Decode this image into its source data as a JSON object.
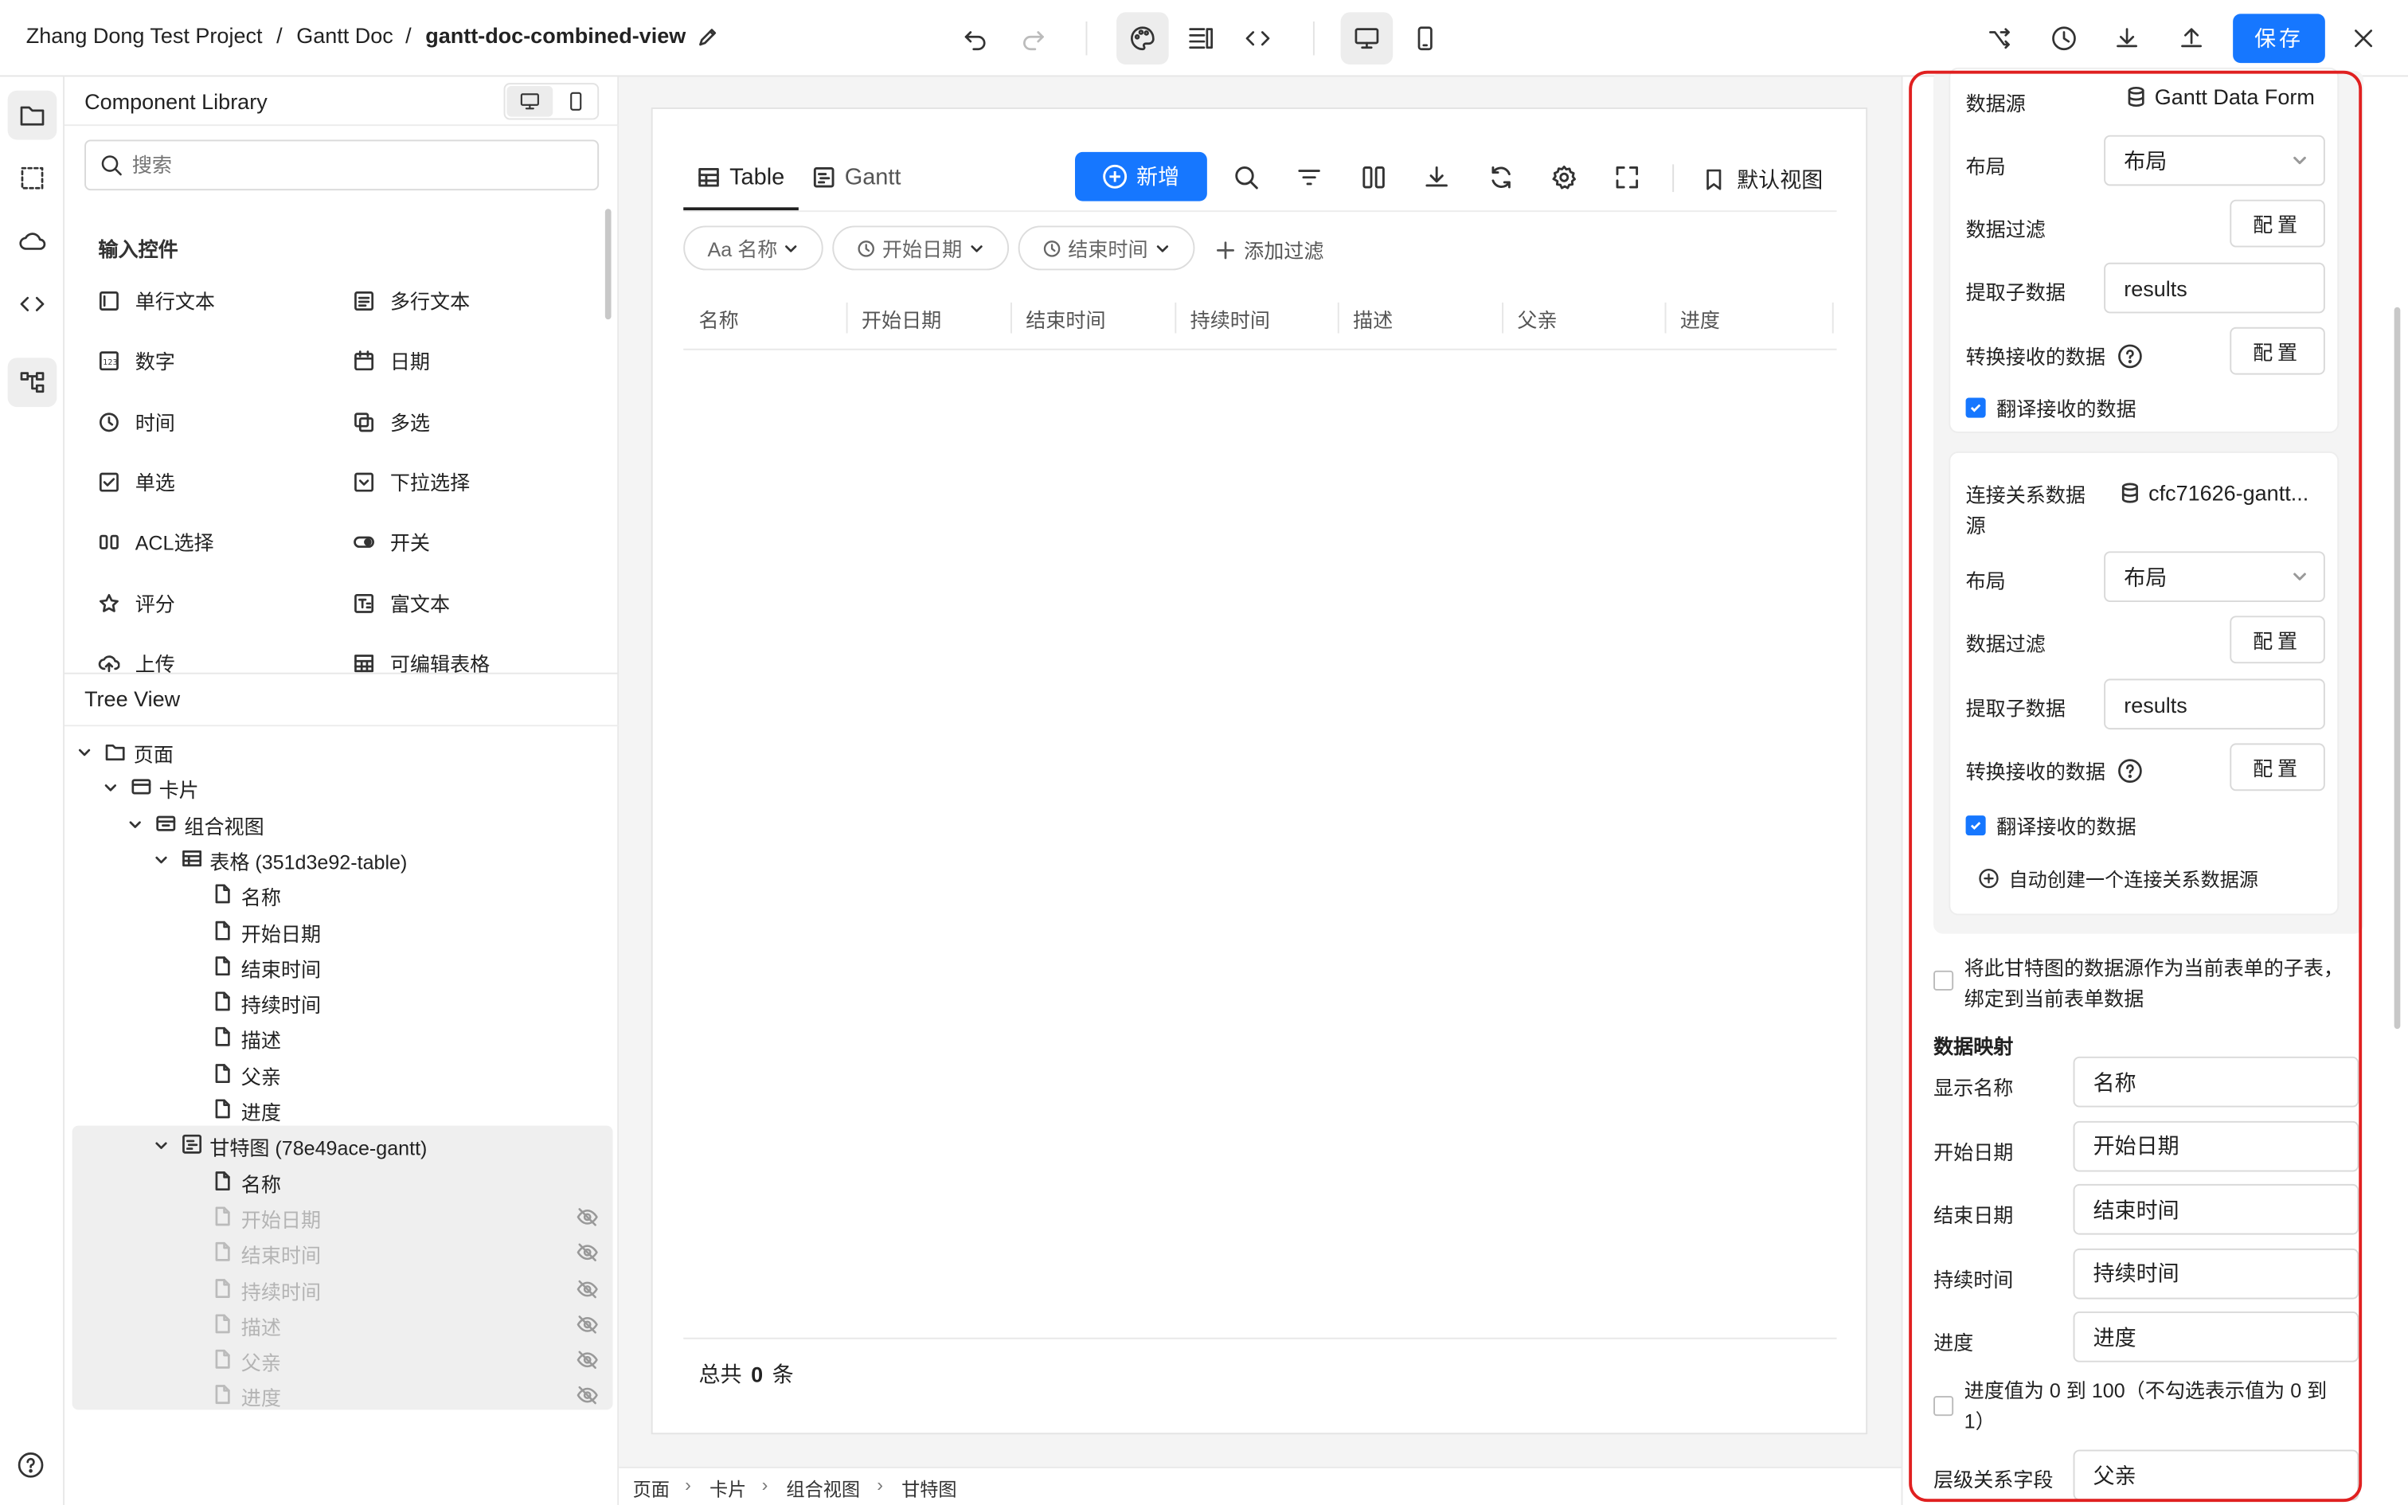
{
  "header": {
    "breadcrumbs": [
      "Zhang Dong Test Project",
      "Gantt Doc",
      "gantt-doc-combined-view"
    ],
    "separator": "/",
    "save_label": "保存"
  },
  "left_panel": {
    "library_title": "Component Library",
    "search_placeholder": "搜索",
    "input_section": "输入控件",
    "components": [
      "单行文本",
      "多行文本",
      "数字",
      "日期",
      "时间",
      "多选",
      "单选",
      "下拉选择",
      "ACL选择",
      "开关",
      "评分",
      "富文本",
      "上传",
      "可编辑表格"
    ],
    "tree_title": "Tree View",
    "tree": [
      {
        "label": "页面",
        "level": 0,
        "icon": "folder-icon",
        "expanded": true
      },
      {
        "label": "卡片",
        "level": 1,
        "icon": "card-icon",
        "expanded": true
      },
      {
        "label": "组合视图",
        "level": 2,
        "icon": "combined-view-icon",
        "expanded": true
      },
      {
        "label": "表格 (351d3e92-table)",
        "level": 3,
        "icon": "table-icon",
        "expanded": true
      },
      {
        "label": "名称",
        "level": 4,
        "icon": "file-icon"
      },
      {
        "label": "开始日期",
        "level": 4,
        "icon": "file-icon"
      },
      {
        "label": "结束时间",
        "level": 4,
        "icon": "file-icon"
      },
      {
        "label": "持续时间",
        "level": 4,
        "icon": "file-icon"
      },
      {
        "label": "描述",
        "level": 4,
        "icon": "file-icon"
      },
      {
        "label": "父亲",
        "level": 4,
        "icon": "file-icon"
      },
      {
        "label": "进度",
        "level": 4,
        "icon": "file-icon"
      },
      {
        "label": "甘特图 (78e49ace-gantt)",
        "level": 3,
        "icon": "gantt-icon",
        "expanded": true,
        "selected": true
      },
      {
        "label": "名称",
        "level": 4,
        "icon": "file-icon",
        "selected": true
      },
      {
        "label": "开始日期",
        "level": 4,
        "icon": "file-icon",
        "hidden": true,
        "selected": true
      },
      {
        "label": "结束时间",
        "level": 4,
        "icon": "file-icon",
        "hidden": true,
        "selected": true
      },
      {
        "label": "持续时间",
        "level": 4,
        "icon": "file-icon",
        "hidden": true,
        "selected": true
      },
      {
        "label": "描述",
        "level": 4,
        "icon": "file-icon",
        "hidden": true,
        "selected": true
      },
      {
        "label": "父亲",
        "level": 4,
        "icon": "file-icon",
        "hidden": true,
        "selected": true
      },
      {
        "label": "进度",
        "level": 4,
        "icon": "file-icon",
        "hidden": true,
        "selected": true
      }
    ]
  },
  "canvas": {
    "tabs": [
      "Table",
      "Gantt"
    ],
    "add_label": "新增",
    "default_view_label": "默认视图",
    "filters": [
      "Aa 名称",
      "开始日期",
      "结束时间"
    ],
    "add_filter_label": "添加过滤",
    "columns": [
      "名称",
      "开始日期",
      "结束时间",
      "持续时间",
      "描述",
      "父亲",
      "进度"
    ],
    "total_prefix": "总共",
    "total_count": "0",
    "total_suffix": "条",
    "breadcrumb": [
      "页面",
      "卡片",
      "组合视图",
      "甘特图"
    ]
  },
  "right_panel": {
    "ds1": {
      "label": "数据源",
      "value": "Gantt Data Form",
      "layout_label": "布局",
      "layout_value": "布局",
      "filter_label": "数据过滤",
      "config_label": "配置",
      "extract_label": "提取子数据",
      "extract_value": "results",
      "transform_label": "转换接收的数据",
      "translate_label": "翻译接收的数据"
    },
    "ds2": {
      "label": "连接关系数据源",
      "value": "cfc71626-gantt...",
      "layout_label": "布局",
      "layout_value": "布局",
      "filter_label": "数据过滤",
      "config_label": "配置",
      "extract_label": "提取子数据",
      "extract_value": "results",
      "transform_label": "转换接收的数据",
      "translate_label": "翻译接收的数据",
      "auto_create_label": "自动创建一个连接关系数据源"
    },
    "bind_sub_label": "将此甘特图的数据源作为当前表单的子表，绑定到当前表单数据",
    "mapping_title": "数据映射",
    "mapping": [
      {
        "label": "显示名称",
        "value": "名称"
      },
      {
        "label": "开始日期",
        "value": "开始日期"
      },
      {
        "label": "结束日期",
        "value": "结束时间"
      },
      {
        "label": "持续时间",
        "value": "持续时间"
      },
      {
        "label": "进度",
        "value": "进度"
      }
    ],
    "progress_range_label": "进度值为 0 到 100（不勾选表示值为 0 到 1）",
    "hierarchy_label": "层级关系字段",
    "hierarchy_value": "父亲"
  },
  "colors": {
    "accent": "#1677ff",
    "highlight_border": "#e02020"
  }
}
